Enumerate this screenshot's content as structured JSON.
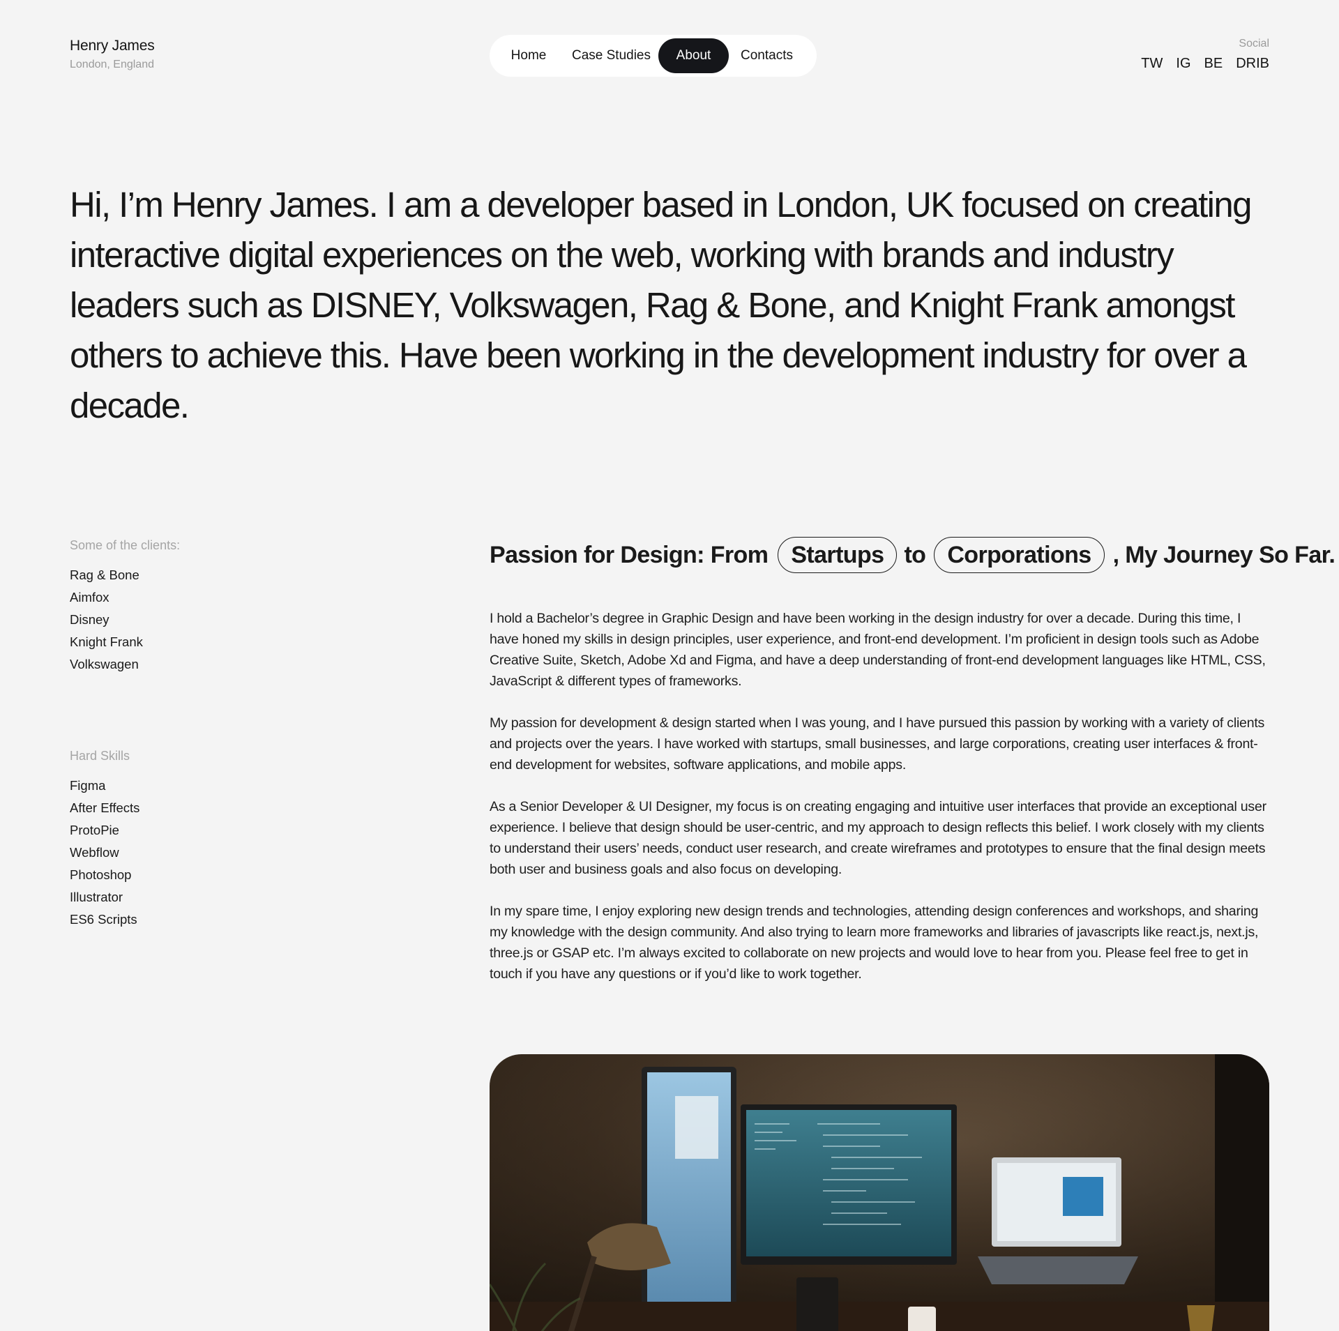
{
  "brand": {
    "name": "Henry James",
    "location": "London, England"
  },
  "nav": {
    "items": [
      {
        "label": "Home",
        "active": false
      },
      {
        "label": "Case Studies",
        "active": false
      },
      {
        "label": "About",
        "active": true
      },
      {
        "label": "Contacts",
        "active": false
      }
    ]
  },
  "social": {
    "label": "Social",
    "links": [
      "TW",
      "IG",
      "BE",
      "DRIB"
    ]
  },
  "intro": {
    "text": "Hi, I’m Henry James. I am a developer based in London, UK focused on creating interactive digital experiences on the web, working with brands and industry leaders such as DISNEY, Volkswagen, Rag & Bone, and Knight Frank amongst others to achieve this. Have been working in the development industry for over a decade."
  },
  "clients": {
    "label": "Some of the clients:",
    "items": [
      "Rag & Bone",
      "Aimfox",
      "Disney",
      "Knight Frank",
      "Volkswagen"
    ]
  },
  "skills": {
    "label": "Hard Skills",
    "items": [
      "Figma",
      "After Effects",
      "ProtoPie",
      "Webflow",
      "Photoshop",
      "Illustrator",
      "ES6 Scripts"
    ]
  },
  "journey": {
    "prefix": "Passion for Design: From",
    "pill1": "Startups",
    "middle": "to",
    "pill2": "Corporations",
    "suffix": ", My Journey So Far."
  },
  "bio": {
    "paragraphs": [
      "I hold a Bachelor’s degree in Graphic Design and have been working in the design industry for over a decade. During this time, I have honed my skills in design principles, user experience, and front-end development. I’m proficient in design tools such as Adobe Creative Suite, Sketch, Adobe Xd and Figma, and have a deep understanding of front-end development languages like HTML, CSS, JavaScript & different types of frameworks.",
      "My passion for development & design started when I was young, and I have pursued this passion by working with a variety of clients and projects over the years. I have worked with startups, small businesses, and large corporations, creating user interfaces & front-end development for websites, software applications, and mobile apps.",
      "As a Senior Developer & UI Designer, my focus is on creating engaging and intuitive user interfaces that provide an exceptional user experience. I believe that design should be user-centric, and my approach to design reflects this belief. I work closely with my clients to understand their users’ needs, conduct user research, and create wireframes and prototypes to ensure that the final design meets both user and business goals and also focus on developing.",
      "In my spare time, I enjoy exploring new design trends and technologies, attending design conferences and workshops, and sharing my knowledge with the design community. And also trying to learn more frameworks and libraries of javascripts like react.js, next.js, three.js or GSAP etc. I’m always excited to collaborate on new projects and would love to hear from you. Please feel free to get in touch if you have any questions or if you’d like to work together."
    ]
  },
  "colors": {
    "background": "#f4f4f4",
    "text": "#141414",
    "muted": "#9a9a9a",
    "nav_active_bg": "#15161a",
    "nav_bg": "#ffffff"
  }
}
